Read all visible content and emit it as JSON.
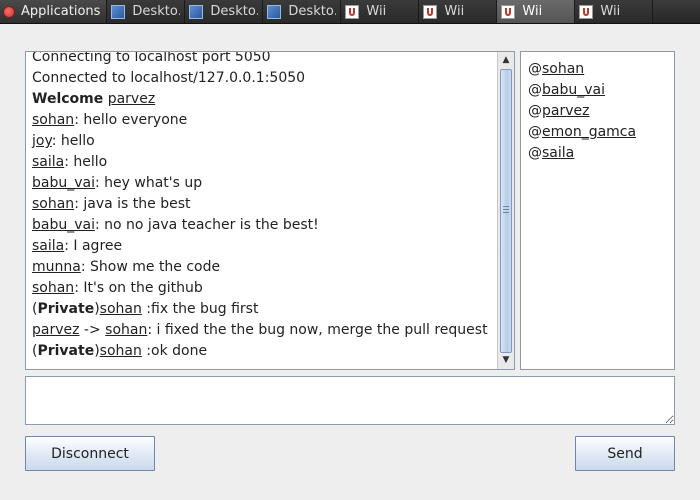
{
  "taskbar": {
    "applications_label": "Applications",
    "tasks": [
      {
        "label": "Deskto…",
        "icon": "desktop-icon",
        "active": false
      },
      {
        "label": "Deskto…",
        "icon": "desktop-icon",
        "active": false
      },
      {
        "label": "Deskto…",
        "icon": "desktop-icon",
        "active": false
      },
      {
        "label": "Wii",
        "icon": "java-icon",
        "active": false
      },
      {
        "label": "Wii",
        "icon": "java-icon",
        "active": false
      },
      {
        "label": "Wii",
        "icon": "java-icon",
        "active": true
      },
      {
        "label": "Wii",
        "icon": "java-icon",
        "active": false
      }
    ]
  },
  "chat": {
    "lines": [
      {
        "text": "Connecting to localhost port 5050"
      },
      {
        "text": "Connected to localhost/127.0.0.1:5050"
      },
      {
        "bold": "Welcome",
        "user": "parvez"
      },
      {
        "user": "sohan",
        "text": ": hello everyone"
      },
      {
        "user": "joy",
        "text": ": hello"
      },
      {
        "user": "saila",
        "text": ": hello"
      },
      {
        "user": "babu_vai",
        "text": ": hey what's up"
      },
      {
        "user": "sohan",
        "text": ": java is the best"
      },
      {
        "user": "babu_vai",
        "text": ": no no java teacher is the best!"
      },
      {
        "user": "saila",
        "text": ": I agree"
      },
      {
        "user": "munna",
        "text": ": Show me the code"
      },
      {
        "user": "sohan",
        "text": ": It's on the github"
      },
      {
        "private": "Private",
        "user": "sohan",
        "text": " :fix the bug first"
      },
      {
        "user": "parvez",
        "arrow": " -> ",
        "to": "sohan",
        "text": ": i fixed the the bug now, merge the pull request"
      },
      {
        "private": "Private",
        "user": "sohan",
        "text": " :ok done"
      }
    ]
  },
  "users": [
    {
      "at": "@",
      "name": "sohan"
    },
    {
      "at": "@",
      "name": "babu_vai"
    },
    {
      "at": "@",
      "name": "parvez"
    },
    {
      "at": "@",
      "name": "emon_gamca"
    },
    {
      "at": "@",
      "name": "saila"
    }
  ],
  "input": {
    "value": "",
    "placeholder": ""
  },
  "buttons": {
    "disconnect": "Disconnect",
    "send": "Send"
  },
  "scroll": {
    "up_glyph": "▲",
    "down_glyph": "▼"
  }
}
